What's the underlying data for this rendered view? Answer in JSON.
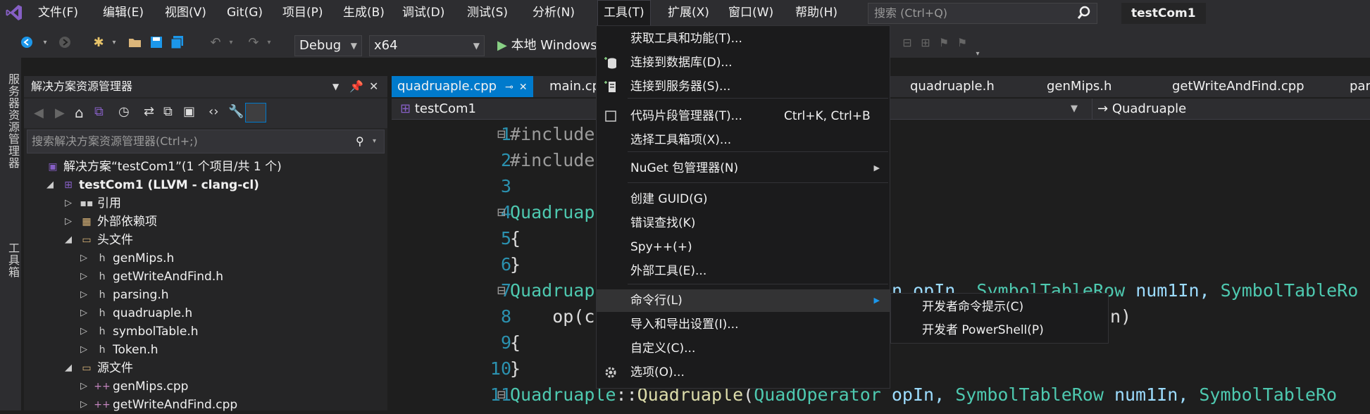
{
  "menubar": {
    "items": [
      "文件(F)",
      "编辑(E)",
      "视图(V)",
      "Git(G)",
      "项目(P)",
      "生成(B)",
      "调试(D)",
      "测试(S)",
      "分析(N)",
      "工具(T)",
      "扩展(X)",
      "窗口(W)",
      "帮助(H)"
    ],
    "active_index": 9,
    "search_placeholder": "搜索 (Ctrl+Q)",
    "solution_title": "testCom1"
  },
  "toolbar": {
    "configuration": "Debug",
    "platform": "x64",
    "run_label": "本地 Windows"
  },
  "left_strip": {
    "server_explorer": "服务器资源管理器",
    "toolbox": "工具箱"
  },
  "solution_explorer": {
    "title": "解决方案资源管理器",
    "search_placeholder": "搜索解决方案资源管理器(Ctrl+;)",
    "tree": [
      {
        "label": "解决方案“testCom1”(1 个项目/共 1 个)",
        "level": 0,
        "icon": "solution-icon",
        "arrow": ""
      },
      {
        "label": "testCom1 (LLVM - clang-cl)",
        "level": 1,
        "icon": "project-icon",
        "arrow": "expanded",
        "bold": true
      },
      {
        "label": "引用",
        "level": 2,
        "icon": "references-icon",
        "arrow": "collapsed"
      },
      {
        "label": "外部依赖项",
        "level": 2,
        "icon": "external-deps-icon",
        "arrow": "collapsed"
      },
      {
        "label": "头文件",
        "level": 2,
        "icon": "folder-icon",
        "arrow": "expanded"
      },
      {
        "label": "genMips.h",
        "level": 3,
        "icon": "header-file-icon",
        "arrow": "collapsed"
      },
      {
        "label": "getWriteAndFind.h",
        "level": 3,
        "icon": "header-file-icon",
        "arrow": "collapsed"
      },
      {
        "label": "parsing.h",
        "level": 3,
        "icon": "header-file-icon",
        "arrow": "collapsed"
      },
      {
        "label": "quadruaple.h",
        "level": 3,
        "icon": "header-file-icon",
        "arrow": "collapsed"
      },
      {
        "label": "symbolTable.h",
        "level": 3,
        "icon": "header-file-icon",
        "arrow": "collapsed"
      },
      {
        "label": "Token.h",
        "level": 3,
        "icon": "header-file-icon",
        "arrow": "collapsed"
      },
      {
        "label": "源文件",
        "level": 2,
        "icon": "folder-icon",
        "arrow": "expanded"
      },
      {
        "label": "genMips.cpp",
        "level": 3,
        "icon": "cpp-file-icon",
        "arrow": "collapsed"
      },
      {
        "label": "getWriteAndFind.cpp",
        "level": 3,
        "icon": "cpp-file-icon",
        "arrow": "collapsed"
      }
    ]
  },
  "editor": {
    "tabs": [
      {
        "label": "quadruaple.cpp",
        "active": true
      },
      {
        "label": "main.cp",
        "active": false
      },
      {
        "label": "quadruaple.h",
        "active": false
      },
      {
        "label": "genMips.h",
        "active": false
      },
      {
        "label": "getWriteAndFind.cpp",
        "active": false
      },
      {
        "label": "parsi",
        "active": false
      }
    ],
    "nav_project": "testCom1",
    "nav_member": "Quadruaple",
    "lines": [
      {
        "n": "1",
        "tokens": [
          {
            "t": "#include",
            "c": "kw-pp"
          }
        ]
      },
      {
        "n": "2",
        "tokens": [
          {
            "t": "#include",
            "c": "kw-pp"
          }
        ]
      },
      {
        "n": "3",
        "tokens": []
      },
      {
        "n": "4",
        "tokens": [
          {
            "t": "Quadruap",
            "c": "kw-type"
          }
        ]
      },
      {
        "n": "5",
        "tokens": [
          {
            "t": "{",
            "c": "kw-plain"
          }
        ]
      },
      {
        "n": "6",
        "tokens": [
          {
            "t": "}",
            "c": "kw-plain"
          }
        ]
      },
      {
        "n": "7",
        "tokens": [
          {
            "t": "Quadruap",
            "c": "kw-type"
          }
        ]
      },
      {
        "n": "8",
        "tokens": [
          {
            "t": "    op(c",
            "c": "kw-plain"
          }
        ]
      },
      {
        "n": "9",
        "tokens": [
          {
            "t": "{",
            "c": "kw-plain"
          }
        ]
      },
      {
        "n": "10",
        "tokens": [
          {
            "t": "}",
            "c": "kw-plain"
          }
        ]
      },
      {
        "n": "11",
        "tokens": [
          {
            "t": "Quadruaple",
            "c": "kw-type"
          },
          {
            "t": "::",
            "c": "kw-plain"
          },
          {
            "t": "Quadruaple",
            "c": "kw-fn"
          },
          {
            "t": "(",
            "c": "kw-plain"
          },
          {
            "t": "QuadOperator",
            "c": "kw-type"
          },
          {
            "t": " opIn, ",
            "c": "kw-param"
          },
          {
            "t": "SymbolTableRow",
            "c": "kw-type"
          },
          {
            "t": " num1In, ",
            "c": "kw-param"
          },
          {
            "t": "SymbolTableRo",
            "c": "kw-type"
          }
        ]
      }
    ],
    "line7_tail": [
      {
        "t": "n opIn, ",
        "c": "kw-param"
      },
      {
        "t": "SymbolTableRow",
        "c": "kw-type"
      },
      {
        "t": " num1In, ",
        "c": "kw-param"
      },
      {
        "t": "SymbolTableRo",
        "c": "kw-type"
      }
    ],
    "line8_tail": "n)"
  },
  "tools_menu": {
    "items": [
      {
        "label": "获取工具和功能(T)...",
        "icon": "",
        "shortcut": "",
        "submenu": false
      },
      {
        "label": "连接到数据库(D)...",
        "icon": "database-connect-icon",
        "shortcut": "",
        "submenu": false
      },
      {
        "label": "连接到服务器(S)...",
        "icon": "server-connect-icon",
        "shortcut": "",
        "submenu": false
      },
      {
        "label": "代码片段管理器(T)...",
        "icon": "snippet-checkbox-icon",
        "shortcut": "Ctrl+K, Ctrl+B",
        "submenu": false
      },
      {
        "label": "选择工具箱项(X)...",
        "icon": "",
        "shortcut": "",
        "submenu": false
      },
      {
        "label": "NuGet 包管理器(N)",
        "icon": "",
        "shortcut": "",
        "submenu": true
      },
      {
        "label": "创建 GUID(G)",
        "icon": "",
        "shortcut": "",
        "submenu": false
      },
      {
        "label": "错误查找(K)",
        "icon": "",
        "shortcut": "",
        "submenu": false
      },
      {
        "label": "Spy++(+)",
        "icon": "",
        "shortcut": "",
        "submenu": false
      },
      {
        "label": "外部工具(E)...",
        "icon": "",
        "shortcut": "",
        "submenu": false
      },
      {
        "label": "命令行(L)",
        "icon": "",
        "shortcut": "",
        "submenu": true
      },
      {
        "label": "导入和导出设置(I)...",
        "icon": "",
        "shortcut": "",
        "submenu": false
      },
      {
        "label": "自定义(C)...",
        "icon": "",
        "shortcut": "",
        "submenu": false
      },
      {
        "label": "选项(O)...",
        "icon": "gear-icon",
        "shortcut": "",
        "submenu": false
      }
    ],
    "hover_index": 10
  },
  "command_line_submenu": {
    "items": [
      "开发者命令提示(C)",
      "开发者 PowerShell(P)"
    ]
  },
  "colors": {
    "accent": "#007acc",
    "menubar_bg": "#2d2d30",
    "editor_bg": "#1e1e1e",
    "type": "#4ec9b0",
    "function": "#dcdcaa",
    "param": "#9cdcfe",
    "line_number": "#2b91af",
    "vs_purple": "#865fc5"
  }
}
